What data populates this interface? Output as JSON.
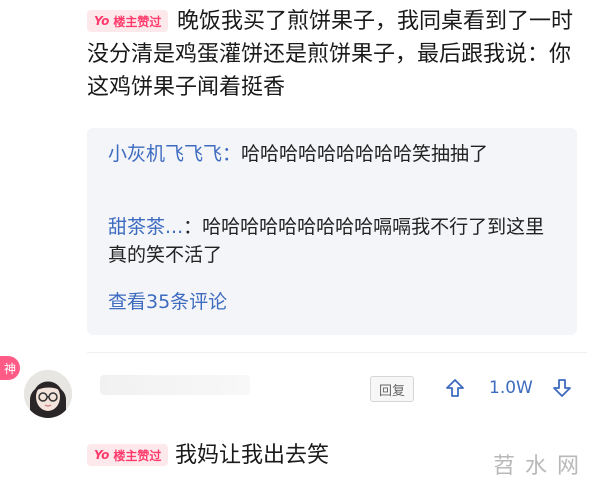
{
  "comment1": {
    "badge": {
      "yo": "Yo",
      "text": "楼主赞过"
    },
    "text": "晚饭我买了煎饼果子，我同桌看到了一时没分清是鸡蛋灌饼还是煎饼果子，最后跟我说：你这鸡饼果子闻着挺香"
  },
  "replies": [
    {
      "user": "小灰机飞飞飞",
      "sep": "：",
      "text": "哈哈哈哈哈哈哈哈哈笑抽抽了"
    },
    {
      "user": "甜茶茶...",
      "sep": "：",
      "text": "哈哈哈哈哈哈哈哈哈嗝嗝我不行了到这里真的笑不活了"
    }
  ],
  "view_more": "查看35条评论",
  "comment2": {
    "tag": "神",
    "reply_label": "回复",
    "likes": "1.0W",
    "badge": {
      "yo": "Yo",
      "text": "楼主赞过"
    },
    "text": "我妈让我出去笑"
  },
  "watermark": "苕水网",
  "colors": {
    "link": "#3d6bbf",
    "badge_bg": "#fde9ec",
    "badge_text": "#ff3b6b",
    "tag": "#ff5b86"
  }
}
